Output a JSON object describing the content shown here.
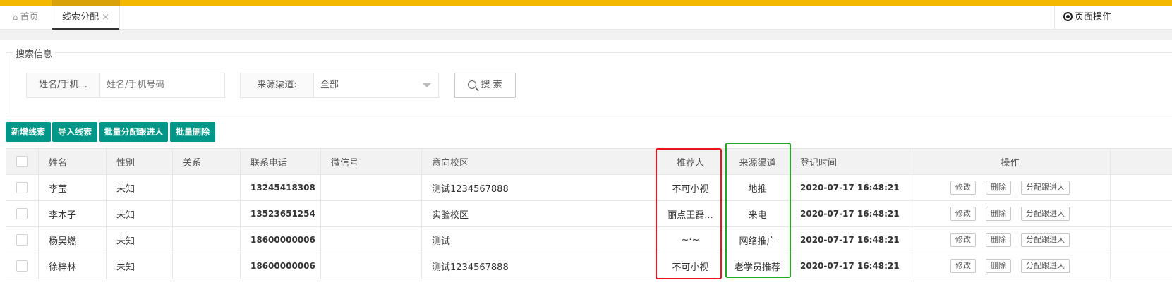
{
  "tabs": {
    "home_label": "首页",
    "active_label": "线索分配",
    "close_glyph": "×",
    "page_ops_label": "页面操作"
  },
  "search": {
    "legend": "搜索信息",
    "name_label": "姓名/手机...",
    "name_placeholder": "姓名/手机号码",
    "source_label": "来源渠道:",
    "source_value": "全部",
    "search_button": "搜 索"
  },
  "toolbar": {
    "add_label": "新增线索",
    "import_label": "导入线索",
    "batch_assign_label": "批量分配跟进人",
    "batch_delete_label": "批量删除"
  },
  "table": {
    "headers": [
      "姓名",
      "性别",
      "关系",
      "联系电话",
      "微信号",
      "意向校区",
      "推荐人",
      "来源渠道",
      "登记时间",
      "操作"
    ],
    "rows": [
      {
        "name": "李莹",
        "gender": "未知",
        "relation": "",
        "phone": "13245418308",
        "wechat": "",
        "campus": "测试1234567888",
        "referrer": "不可小视",
        "source": "地推",
        "time": "2020-07-17 16:48:21"
      },
      {
        "name": "李木子",
        "gender": "未知",
        "relation": "",
        "phone": "13523651254",
        "wechat": "",
        "campus": "实验校区",
        "referrer": "丽点王磊...",
        "source": "来电",
        "time": "2020-07-17 16:48:21"
      },
      {
        "name": "杨昊燃",
        "gender": "未知",
        "relation": "",
        "phone": "18600000006",
        "wechat": "",
        "campus": "测试",
        "referrer": "~·~",
        "source": "网络推广",
        "time": "2020-07-17 16:48:21"
      },
      {
        "name": "徐梓林",
        "gender": "未知",
        "relation": "",
        "phone": "18600000006",
        "wechat": "",
        "campus": "测试1234567888",
        "referrer": "不可小视",
        "source": "老学员推荐",
        "time": "2020-07-17 16:48:21"
      }
    ],
    "row_actions": {
      "edit": "修改",
      "delete": "删除",
      "assign": "分配跟进人"
    }
  },
  "colors": {
    "accent_bar": "#f5b800",
    "primary_button": "#009688",
    "highlight_red": "#e8141e",
    "highlight_green": "#23a823"
  },
  "icons": [
    "home-icon",
    "close-icon",
    "target-icon",
    "chevron-down-icon",
    "search-icon"
  ]
}
